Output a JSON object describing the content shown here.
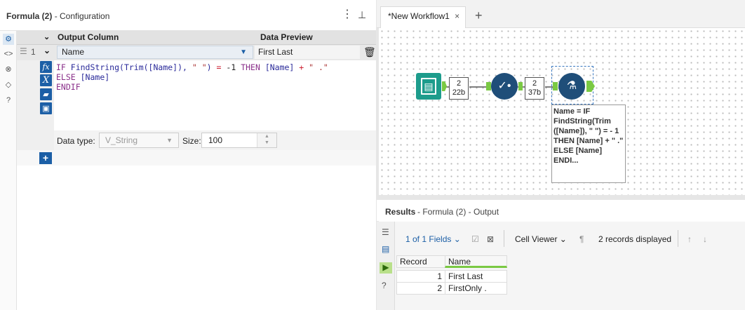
{
  "config": {
    "title_bold": "Formula (2)",
    "title_rest": "- Configuration",
    "menu_icon": "⋮",
    "pin_icon": "⊥"
  },
  "grid": {
    "col_output": "Output Column",
    "col_preview": "Data Preview",
    "row_number": "1",
    "output_name": "Name",
    "preview_value": "First Last",
    "expression_lines": [
      "IF FindString(Trim([Name]), \" \") = -1 THEN [Name] + \" .\"",
      "ELSE [Name]",
      "ENDIF"
    ],
    "data_type_label": "Data type:",
    "data_type_value": "V_String",
    "size_label": "Size:",
    "size_value": "100"
  },
  "workflow": {
    "tab_label": "*New Workflow1",
    "tab_close": "×",
    "tab_add": "+",
    "badge1_top": "2",
    "badge1_bottom": "22b",
    "badge2_top": "2",
    "badge2_bottom": "37b",
    "annotation": "Name = IF FindString(Trim ([Name]), \" \") = - 1 THEN [Name] + \" .\" ELSE [Name] ENDI..."
  },
  "results": {
    "title_bold": "Results",
    "title_rest": "- Formula (2) - Output",
    "fields": "1 of 1 Fields",
    "viewer": "Cell Viewer",
    "records": "2 records displayed",
    "col_record": "Record",
    "col_name": "Name",
    "rows": [
      {
        "record": "1",
        "name": "First Last"
      },
      {
        "record": "2",
        "name": "FirstOnly ."
      }
    ]
  },
  "colors": {
    "accent": "#1c5fa6",
    "teal": "#1d9c8c",
    "navy": "#1f4e79",
    "green": "#7ac943"
  }
}
